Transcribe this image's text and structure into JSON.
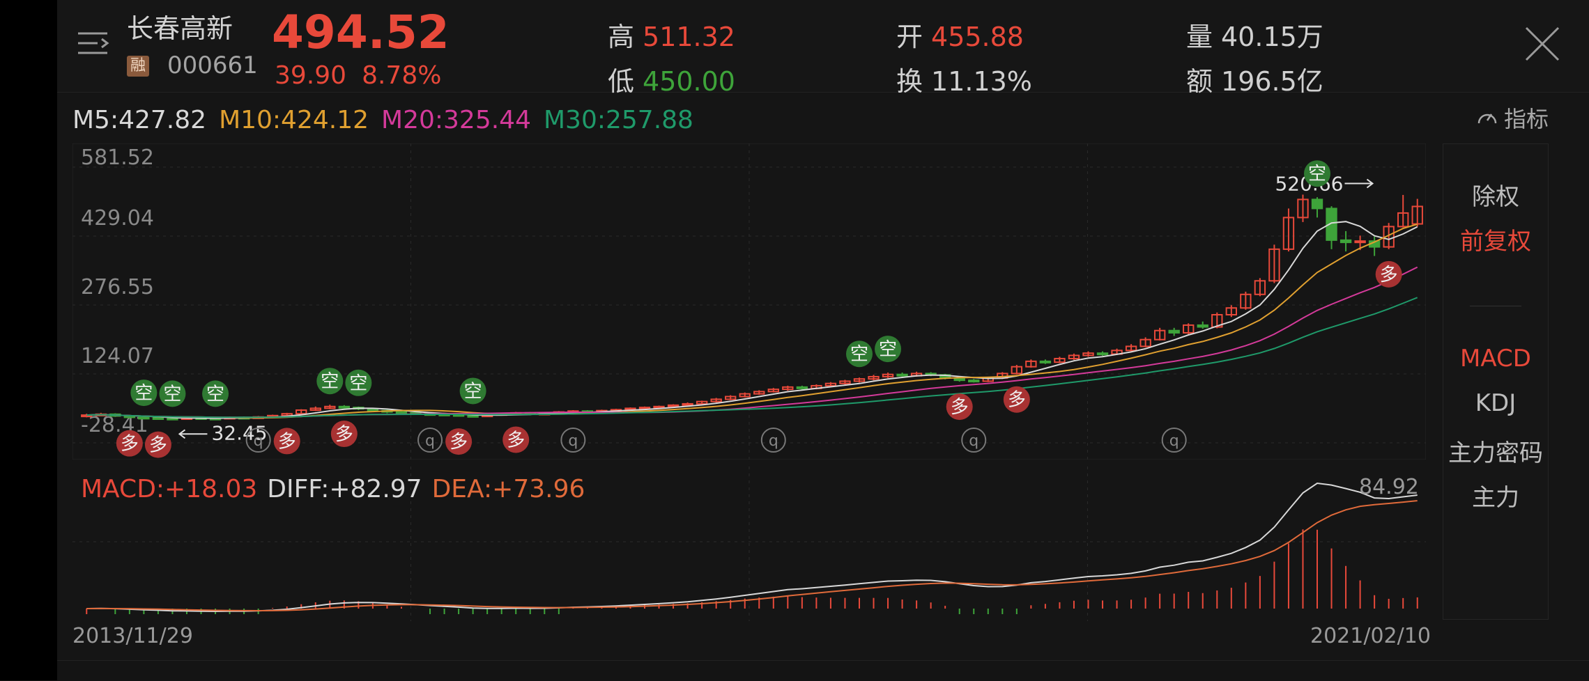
{
  "header": {
    "stock_name": "长春高新",
    "margin_badge": "融",
    "stock_code": "000661",
    "price": "494.52",
    "change_amount": "39.90",
    "change_percent": "8.78%",
    "high_label": "高",
    "high_value": "511.32",
    "low_label": "低",
    "low_value": "450.00",
    "open_label": "开",
    "open_value": "455.88",
    "turnover_label": "换",
    "turnover_value": "11.13%",
    "volume_label": "量",
    "volume_value": "40.15万",
    "amount_label": "额",
    "amount_value": "196.5亿",
    "colors": {
      "up": "#e8493a",
      "down": "#3ea43a"
    }
  },
  "ma_bar": {
    "m5": "M5:427.82",
    "m10": "M10:424.12",
    "m20": "M20:325.44",
    "m30": "M30:257.88",
    "colors": {
      "m5": "#d8d8d8",
      "m10": "#e0a030",
      "m20": "#d43a9a",
      "m30": "#1f9a6a"
    }
  },
  "indicator_link": "指标",
  "chart_data": [
    {
      "type": "candlestick",
      "y_tick_labels": [
        "581.52",
        "429.04",
        "276.55",
        "124.07",
        "-28.41"
      ],
      "ylim": [
        -28.41,
        581.52
      ],
      "x_range_labels": [
        "2013/11/29",
        "2021/02/10"
      ],
      "annotations": {
        "high": "520.66",
        "low": "32.45",
        "buy": "多",
        "sell": "空",
        "q": "q"
      },
      "candles": [
        {
          "o": 30,
          "c": 33,
          "h": 36,
          "l": 28
        },
        {
          "o": 33,
          "c": 35,
          "h": 38,
          "l": 31
        },
        {
          "o": 35,
          "c": 31,
          "h": 37,
          "l": 29
        },
        {
          "o": 31,
          "c": 28,
          "h": 33,
          "l": 26
        },
        {
          "o": 28,
          "c": 27,
          "h": 30,
          "l": 24
        },
        {
          "o": 27,
          "c": 26,
          "h": 29,
          "l": 23
        },
        {
          "o": 26,
          "c": 25,
          "h": 28,
          "l": 22
        },
        {
          "o": 25,
          "c": 27,
          "h": 29,
          "l": 23
        },
        {
          "o": 27,
          "c": 26,
          "h": 28,
          "l": 24
        },
        {
          "o": 26,
          "c": 25,
          "h": 28,
          "l": 23
        },
        {
          "o": 25,
          "c": 28,
          "h": 30,
          "l": 24
        },
        {
          "o": 28,
          "c": 27,
          "h": 30,
          "l": 25
        },
        {
          "o": 27,
          "c": 29,
          "h": 31,
          "l": 26
        },
        {
          "o": 29,
          "c": 32,
          "h": 34,
          "l": 28
        },
        {
          "o": 32,
          "c": 36,
          "h": 38,
          "l": 31
        },
        {
          "o": 36,
          "c": 44,
          "h": 46,
          "l": 35
        },
        {
          "o": 44,
          "c": 48,
          "h": 52,
          "l": 42
        },
        {
          "o": 48,
          "c": 52,
          "h": 56,
          "l": 46
        },
        {
          "o": 52,
          "c": 50,
          "h": 55,
          "l": 47
        },
        {
          "o": 50,
          "c": 47,
          "h": 52,
          "l": 44
        },
        {
          "o": 47,
          "c": 43,
          "h": 49,
          "l": 40
        },
        {
          "o": 43,
          "c": 40,
          "h": 45,
          "l": 37
        },
        {
          "o": 40,
          "c": 38,
          "h": 42,
          "l": 35
        },
        {
          "o": 38,
          "c": 36,
          "h": 40,
          "l": 34
        },
        {
          "o": 36,
          "c": 35,
          "h": 38,
          "l": 33
        },
        {
          "o": 35,
          "c": 34,
          "h": 37,
          "l": 32
        },
        {
          "o": 34,
          "c": 32,
          "h": 36,
          "l": 30
        },
        {
          "o": 32,
          "c": 30,
          "h": 34,
          "l": 28
        },
        {
          "o": 30,
          "c": 33,
          "h": 35,
          "l": 29
        },
        {
          "o": 33,
          "c": 36,
          "h": 38,
          "l": 32
        },
        {
          "o": 36,
          "c": 38,
          "h": 40,
          "l": 34
        },
        {
          "o": 38,
          "c": 35,
          "h": 40,
          "l": 33
        },
        {
          "o": 35,
          "c": 37,
          "h": 39,
          "l": 34
        },
        {
          "o": 37,
          "c": 40,
          "h": 42,
          "l": 36
        },
        {
          "o": 40,
          "c": 42,
          "h": 44,
          "l": 38
        },
        {
          "o": 42,
          "c": 41,
          "h": 44,
          "l": 39
        },
        {
          "o": 41,
          "c": 43,
          "h": 45,
          "l": 40
        },
        {
          "o": 43,
          "c": 45,
          "h": 47,
          "l": 42
        },
        {
          "o": 45,
          "c": 48,
          "h": 50,
          "l": 44
        },
        {
          "o": 48,
          "c": 50,
          "h": 52,
          "l": 46
        },
        {
          "o": 50,
          "c": 52,
          "h": 54,
          "l": 48
        },
        {
          "o": 52,
          "c": 55,
          "h": 57,
          "l": 50
        },
        {
          "o": 55,
          "c": 58,
          "h": 61,
          "l": 53
        },
        {
          "o": 58,
          "c": 63,
          "h": 65,
          "l": 56
        },
        {
          "o": 63,
          "c": 68,
          "h": 71,
          "l": 61
        },
        {
          "o": 68,
          "c": 74,
          "h": 77,
          "l": 66
        },
        {
          "o": 74,
          "c": 80,
          "h": 83,
          "l": 72
        },
        {
          "o": 80,
          "c": 85,
          "h": 88,
          "l": 78
        },
        {
          "o": 85,
          "c": 90,
          "h": 93,
          "l": 83
        },
        {
          "o": 90,
          "c": 95,
          "h": 98,
          "l": 87
        },
        {
          "o": 95,
          "c": 92,
          "h": 98,
          "l": 88
        },
        {
          "o": 92,
          "c": 98,
          "h": 101,
          "l": 90
        },
        {
          "o": 98,
          "c": 103,
          "h": 106,
          "l": 96
        },
        {
          "o": 103,
          "c": 108,
          "h": 111,
          "l": 100
        },
        {
          "o": 108,
          "c": 113,
          "h": 116,
          "l": 105
        },
        {
          "o": 113,
          "c": 118,
          "h": 122,
          "l": 110
        },
        {
          "o": 118,
          "c": 123,
          "h": 127,
          "l": 115
        },
        {
          "o": 123,
          "c": 120,
          "h": 127,
          "l": 117
        },
        {
          "o": 120,
          "c": 125,
          "h": 129,
          "l": 118
        },
        {
          "o": 125,
          "c": 122,
          "h": 128,
          "l": 119
        },
        {
          "o": 122,
          "c": 115,
          "h": 124,
          "l": 112
        },
        {
          "o": 115,
          "c": 110,
          "h": 118,
          "l": 107
        },
        {
          "o": 110,
          "c": 108,
          "h": 113,
          "l": 105
        },
        {
          "o": 108,
          "c": 115,
          "h": 118,
          "l": 106
        },
        {
          "o": 115,
          "c": 125,
          "h": 128,
          "l": 113
        },
        {
          "o": 125,
          "c": 140,
          "h": 144,
          "l": 123
        },
        {
          "o": 140,
          "c": 152,
          "h": 156,
          "l": 138
        },
        {
          "o": 152,
          "c": 150,
          "h": 156,
          "l": 146
        },
        {
          "o": 150,
          "c": 158,
          "h": 162,
          "l": 148
        },
        {
          "o": 158,
          "c": 165,
          "h": 169,
          "l": 155
        },
        {
          "o": 165,
          "c": 170,
          "h": 174,
          "l": 162
        },
        {
          "o": 170,
          "c": 168,
          "h": 174,
          "l": 164
        },
        {
          "o": 168,
          "c": 176,
          "h": 180,
          "l": 166
        },
        {
          "o": 176,
          "c": 185,
          "h": 190,
          "l": 174
        },
        {
          "o": 185,
          "c": 200,
          "h": 205,
          "l": 183
        },
        {
          "o": 200,
          "c": 220,
          "h": 226,
          "l": 198
        },
        {
          "o": 220,
          "c": 215,
          "h": 226,
          "l": 208
        },
        {
          "o": 215,
          "c": 232,
          "h": 236,
          "l": 212
        },
        {
          "o": 232,
          "c": 228,
          "h": 240,
          "l": 224
        },
        {
          "o": 228,
          "c": 255,
          "h": 260,
          "l": 225
        },
        {
          "o": 255,
          "c": 270,
          "h": 276,
          "l": 250
        },
        {
          "o": 270,
          "c": 300,
          "h": 306,
          "l": 266
        },
        {
          "o": 300,
          "c": 330,
          "h": 336,
          "l": 296
        },
        {
          "o": 330,
          "c": 400,
          "h": 410,
          "l": 325
        },
        {
          "o": 400,
          "c": 470,
          "h": 490,
          "l": 395
        },
        {
          "o": 470,
          "c": 510,
          "h": 520.66,
          "l": 460
        },
        {
          "o": 510,
          "c": 490,
          "h": 515,
          "l": 470
        },
        {
          "o": 490,
          "c": 420,
          "h": 495,
          "l": 400
        },
        {
          "o": 420,
          "c": 415,
          "h": 440,
          "l": 395
        },
        {
          "o": 415,
          "c": 418,
          "h": 430,
          "l": 398
        },
        {
          "o": 418,
          "c": 405,
          "h": 428,
          "l": 385
        },
        {
          "o": 405,
          "c": 450,
          "h": 458,
          "l": 400
        },
        {
          "o": 450,
          "c": 480,
          "h": 520,
          "l": 448
        },
        {
          "o": 455.88,
          "c": 494.52,
          "h": 511.32,
          "l": 450
        }
      ]
    },
    {
      "type": "macd",
      "max_label": "84.92",
      "legend": {
        "macd": "MACD:+18.03",
        "diff": "DIFF:+82.97",
        "dea": "DEA:+73.96"
      },
      "colors": {
        "macd": "#e8493a",
        "diff": "#d8d8d8",
        "dea": "#e06a3a"
      }
    }
  ],
  "side_panel": {
    "items": [
      "除权",
      "前复权",
      "MACD",
      "KDJ",
      "主力密码",
      "主力"
    ],
    "active": [
      "前复权",
      "MACD"
    ]
  }
}
